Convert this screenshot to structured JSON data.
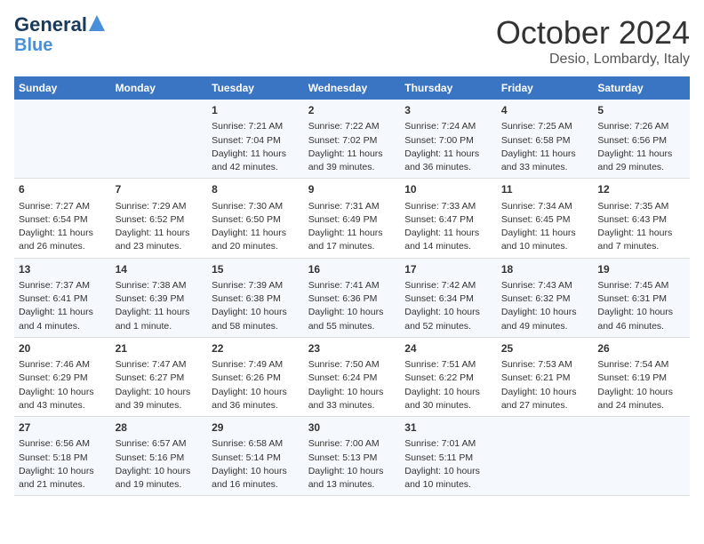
{
  "logo": {
    "line1": "General",
    "line2": "Blue"
  },
  "title": "October 2024",
  "location": "Desio, Lombardy, Italy",
  "headers": [
    "Sunday",
    "Monday",
    "Tuesday",
    "Wednesday",
    "Thursday",
    "Friday",
    "Saturday"
  ],
  "weeks": [
    [
      {
        "day": "",
        "sunrise": "",
        "sunset": "",
        "daylight": ""
      },
      {
        "day": "",
        "sunrise": "",
        "sunset": "",
        "daylight": ""
      },
      {
        "day": "1",
        "sunrise": "Sunrise: 7:21 AM",
        "sunset": "Sunset: 7:04 PM",
        "daylight": "Daylight: 11 hours and 42 minutes."
      },
      {
        "day": "2",
        "sunrise": "Sunrise: 7:22 AM",
        "sunset": "Sunset: 7:02 PM",
        "daylight": "Daylight: 11 hours and 39 minutes."
      },
      {
        "day": "3",
        "sunrise": "Sunrise: 7:24 AM",
        "sunset": "Sunset: 7:00 PM",
        "daylight": "Daylight: 11 hours and 36 minutes."
      },
      {
        "day": "4",
        "sunrise": "Sunrise: 7:25 AM",
        "sunset": "Sunset: 6:58 PM",
        "daylight": "Daylight: 11 hours and 33 minutes."
      },
      {
        "day": "5",
        "sunrise": "Sunrise: 7:26 AM",
        "sunset": "Sunset: 6:56 PM",
        "daylight": "Daylight: 11 hours and 29 minutes."
      }
    ],
    [
      {
        "day": "6",
        "sunrise": "Sunrise: 7:27 AM",
        "sunset": "Sunset: 6:54 PM",
        "daylight": "Daylight: 11 hours and 26 minutes."
      },
      {
        "day": "7",
        "sunrise": "Sunrise: 7:29 AM",
        "sunset": "Sunset: 6:52 PM",
        "daylight": "Daylight: 11 hours and 23 minutes."
      },
      {
        "day": "8",
        "sunrise": "Sunrise: 7:30 AM",
        "sunset": "Sunset: 6:50 PM",
        "daylight": "Daylight: 11 hours and 20 minutes."
      },
      {
        "day": "9",
        "sunrise": "Sunrise: 7:31 AM",
        "sunset": "Sunset: 6:49 PM",
        "daylight": "Daylight: 11 hours and 17 minutes."
      },
      {
        "day": "10",
        "sunrise": "Sunrise: 7:33 AM",
        "sunset": "Sunset: 6:47 PM",
        "daylight": "Daylight: 11 hours and 14 minutes."
      },
      {
        "day": "11",
        "sunrise": "Sunrise: 7:34 AM",
        "sunset": "Sunset: 6:45 PM",
        "daylight": "Daylight: 11 hours and 10 minutes."
      },
      {
        "day": "12",
        "sunrise": "Sunrise: 7:35 AM",
        "sunset": "Sunset: 6:43 PM",
        "daylight": "Daylight: 11 hours and 7 minutes."
      }
    ],
    [
      {
        "day": "13",
        "sunrise": "Sunrise: 7:37 AM",
        "sunset": "Sunset: 6:41 PM",
        "daylight": "Daylight: 11 hours and 4 minutes."
      },
      {
        "day": "14",
        "sunrise": "Sunrise: 7:38 AM",
        "sunset": "Sunset: 6:39 PM",
        "daylight": "Daylight: 11 hours and 1 minute."
      },
      {
        "day": "15",
        "sunrise": "Sunrise: 7:39 AM",
        "sunset": "Sunset: 6:38 PM",
        "daylight": "Daylight: 10 hours and 58 minutes."
      },
      {
        "day": "16",
        "sunrise": "Sunrise: 7:41 AM",
        "sunset": "Sunset: 6:36 PM",
        "daylight": "Daylight: 10 hours and 55 minutes."
      },
      {
        "day": "17",
        "sunrise": "Sunrise: 7:42 AM",
        "sunset": "Sunset: 6:34 PM",
        "daylight": "Daylight: 10 hours and 52 minutes."
      },
      {
        "day": "18",
        "sunrise": "Sunrise: 7:43 AM",
        "sunset": "Sunset: 6:32 PM",
        "daylight": "Daylight: 10 hours and 49 minutes."
      },
      {
        "day": "19",
        "sunrise": "Sunrise: 7:45 AM",
        "sunset": "Sunset: 6:31 PM",
        "daylight": "Daylight: 10 hours and 46 minutes."
      }
    ],
    [
      {
        "day": "20",
        "sunrise": "Sunrise: 7:46 AM",
        "sunset": "Sunset: 6:29 PM",
        "daylight": "Daylight: 10 hours and 43 minutes."
      },
      {
        "day": "21",
        "sunrise": "Sunrise: 7:47 AM",
        "sunset": "Sunset: 6:27 PM",
        "daylight": "Daylight: 10 hours and 39 minutes."
      },
      {
        "day": "22",
        "sunrise": "Sunrise: 7:49 AM",
        "sunset": "Sunset: 6:26 PM",
        "daylight": "Daylight: 10 hours and 36 minutes."
      },
      {
        "day": "23",
        "sunrise": "Sunrise: 7:50 AM",
        "sunset": "Sunset: 6:24 PM",
        "daylight": "Daylight: 10 hours and 33 minutes."
      },
      {
        "day": "24",
        "sunrise": "Sunrise: 7:51 AM",
        "sunset": "Sunset: 6:22 PM",
        "daylight": "Daylight: 10 hours and 30 minutes."
      },
      {
        "day": "25",
        "sunrise": "Sunrise: 7:53 AM",
        "sunset": "Sunset: 6:21 PM",
        "daylight": "Daylight: 10 hours and 27 minutes."
      },
      {
        "day": "26",
        "sunrise": "Sunrise: 7:54 AM",
        "sunset": "Sunset: 6:19 PM",
        "daylight": "Daylight: 10 hours and 24 minutes."
      }
    ],
    [
      {
        "day": "27",
        "sunrise": "Sunrise: 6:56 AM",
        "sunset": "Sunset: 5:18 PM",
        "daylight": "Daylight: 10 hours and 21 minutes."
      },
      {
        "day": "28",
        "sunrise": "Sunrise: 6:57 AM",
        "sunset": "Sunset: 5:16 PM",
        "daylight": "Daylight: 10 hours and 19 minutes."
      },
      {
        "day": "29",
        "sunrise": "Sunrise: 6:58 AM",
        "sunset": "Sunset: 5:14 PM",
        "daylight": "Daylight: 10 hours and 16 minutes."
      },
      {
        "day": "30",
        "sunrise": "Sunrise: 7:00 AM",
        "sunset": "Sunset: 5:13 PM",
        "daylight": "Daylight: 10 hours and 13 minutes."
      },
      {
        "day": "31",
        "sunrise": "Sunrise: 7:01 AM",
        "sunset": "Sunset: 5:11 PM",
        "daylight": "Daylight: 10 hours and 10 minutes."
      },
      {
        "day": "",
        "sunrise": "",
        "sunset": "",
        "daylight": ""
      },
      {
        "day": "",
        "sunrise": "",
        "sunset": "",
        "daylight": ""
      }
    ]
  ]
}
